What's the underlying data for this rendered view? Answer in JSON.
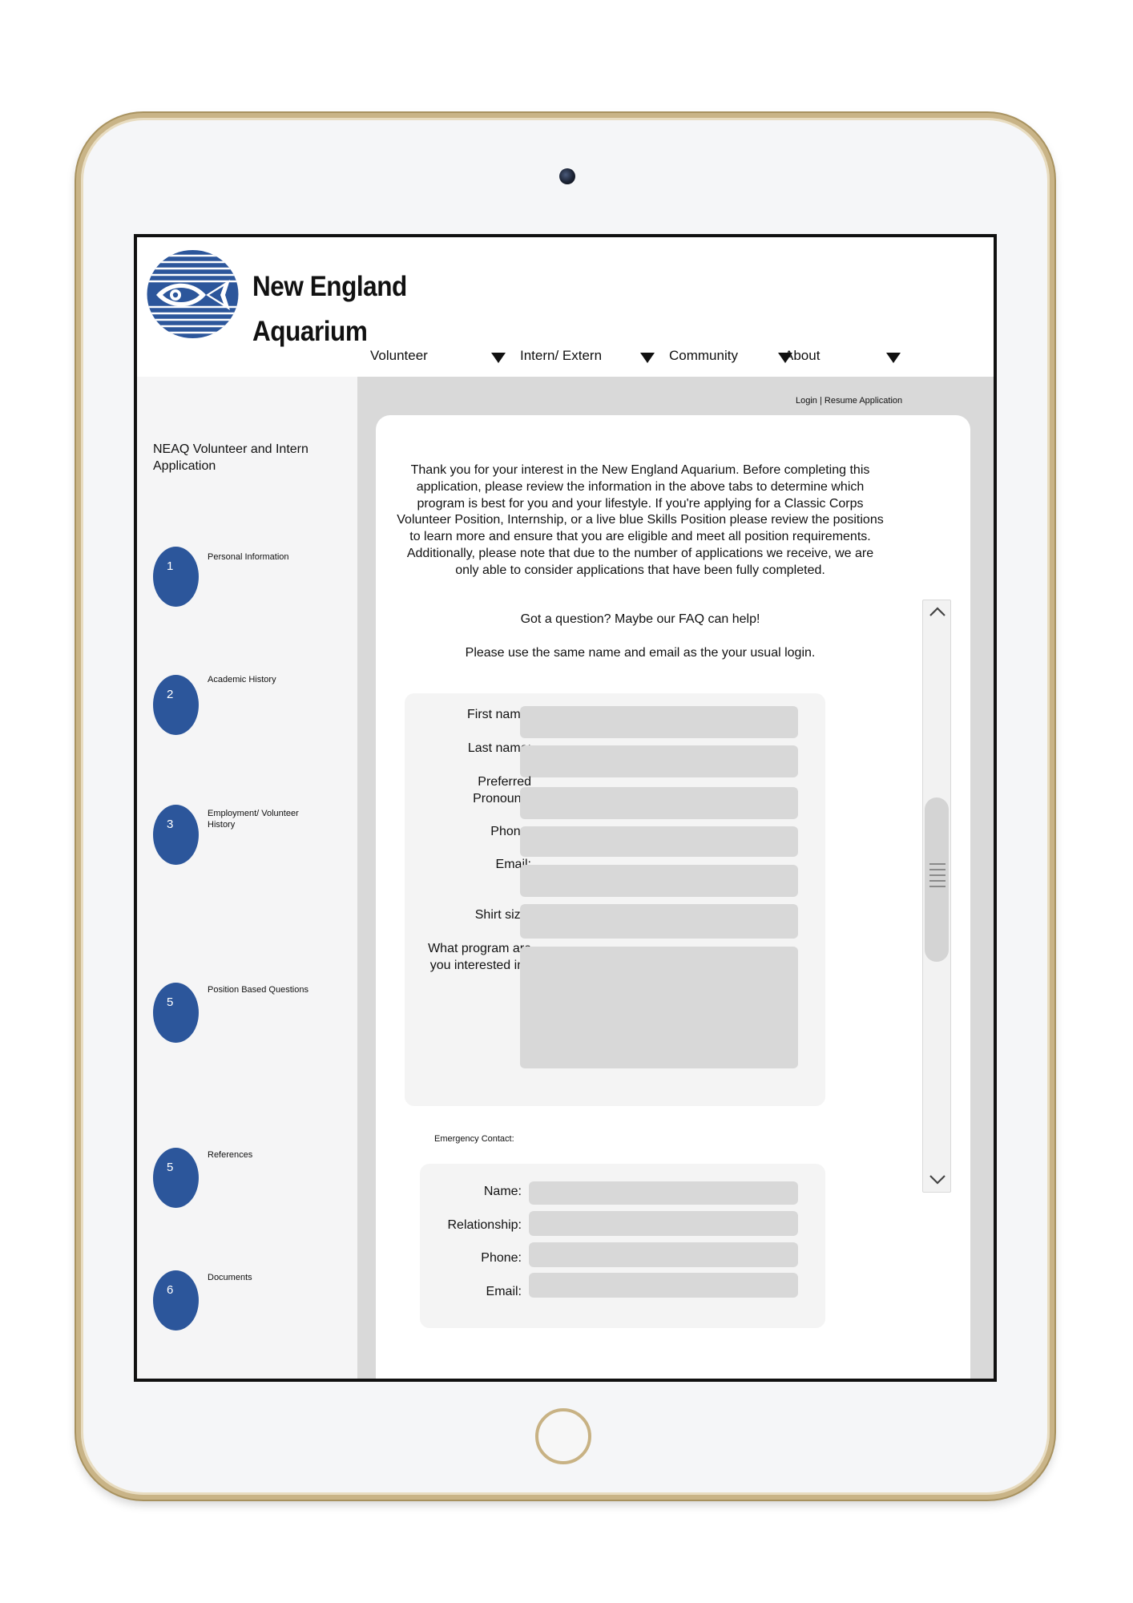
{
  "brand": {
    "line1": "New England",
    "line2": "Aquarium"
  },
  "nav": [
    {
      "label": "Volunteer"
    },
    {
      "label": "Intern/ Extern"
    },
    {
      "label": "Community"
    },
    {
      "label": "About"
    }
  ],
  "top_links": {
    "login": "Login",
    "separator": "|",
    "resume": "Resume Application"
  },
  "sidebar": {
    "title": "NEAQ Volunteer and Intern Application",
    "steps": [
      {
        "number": "1",
        "label": "Personal Information"
      },
      {
        "number": "2",
        "label": "Academic History"
      },
      {
        "number": "3",
        "label": "Employment/ Volunteer History"
      },
      {
        "number": "5",
        "label": "Position Based Questions"
      },
      {
        "number": "5",
        "label": "References"
      },
      {
        "number": "6",
        "label": "Documents"
      }
    ]
  },
  "intro_text": "Thank you for your interest in the New England Aquarium. Before completing this application, please review the information in the above tabs to determine which program is best for you and your lifestyle. If you're applying for a Classic Corps Volunteer Position, Internship, or a live blue Skills Position please review the positions to learn more and ensure that you are eligible and meet all position requirements. Additionally, please note that due to the number of applications we receive, we are only able to consider applications that have been fully completed.",
  "faq_text": "Got a question? Maybe our FAQ can help!",
  "login_note": "Please use the same name and email as the your usual login.",
  "form": {
    "first_name": "First name:",
    "last_name": "Last name:",
    "pronouns_line1": "Preferred",
    "pronouns_line2": "Pronouns:",
    "phone": "Phone:",
    "email": "Email:",
    "shirt_size": "Shirt size:",
    "program_line1": "What program are",
    "program_line2": "you interested in?"
  },
  "emergency": {
    "title": "Emergency Contact:",
    "name": "Name:",
    "relationship": "Relationship:",
    "phone": "Phone:",
    "email": "Email:"
  },
  "icons": {
    "logo": "fish-logo-icon",
    "nav_arrow": "triangle-down-icon",
    "scroll_up": "chevron-up-icon",
    "scroll_down": "chevron-down-icon"
  },
  "colors": {
    "accent_blue": "#2c569b",
    "main_gray": "#d9d9d9",
    "input_gray": "#d8d8d8",
    "sidebar_bg": "#f5f5f6",
    "frame_gold": "#c9b487"
  }
}
